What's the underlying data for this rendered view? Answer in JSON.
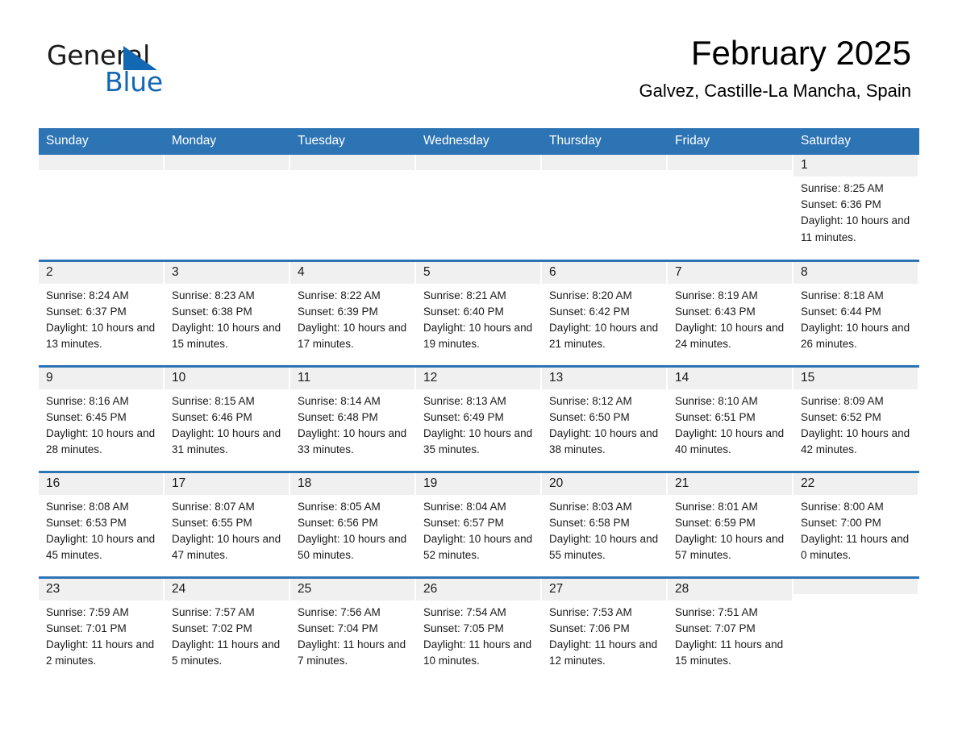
{
  "brand": {
    "name_part1": "General",
    "name_part2": "Blue",
    "accent_color": "#1268b3"
  },
  "header": {
    "title": "February 2025",
    "subtitle": "Galvez, Castille-La Mancha, Spain"
  },
  "calendar": {
    "header_color": "#2d74b5",
    "weekdays": [
      "Sunday",
      "Monday",
      "Tuesday",
      "Wednesday",
      "Thursday",
      "Friday",
      "Saturday"
    ],
    "weeks": [
      [
        {
          "day": ""
        },
        {
          "day": ""
        },
        {
          "day": ""
        },
        {
          "day": ""
        },
        {
          "day": ""
        },
        {
          "day": ""
        },
        {
          "day": "1",
          "sunrise": "Sunrise: 8:25 AM",
          "sunset": "Sunset: 6:36 PM",
          "daylight": "Daylight: 10 hours and 11 minutes."
        }
      ],
      [
        {
          "day": "2",
          "sunrise": "Sunrise: 8:24 AM",
          "sunset": "Sunset: 6:37 PM",
          "daylight": "Daylight: 10 hours and 13 minutes."
        },
        {
          "day": "3",
          "sunrise": "Sunrise: 8:23 AM",
          "sunset": "Sunset: 6:38 PM",
          "daylight": "Daylight: 10 hours and 15 minutes."
        },
        {
          "day": "4",
          "sunrise": "Sunrise: 8:22 AM",
          "sunset": "Sunset: 6:39 PM",
          "daylight": "Daylight: 10 hours and 17 minutes."
        },
        {
          "day": "5",
          "sunrise": "Sunrise: 8:21 AM",
          "sunset": "Sunset: 6:40 PM",
          "daylight": "Daylight: 10 hours and 19 minutes."
        },
        {
          "day": "6",
          "sunrise": "Sunrise: 8:20 AM",
          "sunset": "Sunset: 6:42 PM",
          "daylight": "Daylight: 10 hours and 21 minutes."
        },
        {
          "day": "7",
          "sunrise": "Sunrise: 8:19 AM",
          "sunset": "Sunset: 6:43 PM",
          "daylight": "Daylight: 10 hours and 24 minutes."
        },
        {
          "day": "8",
          "sunrise": "Sunrise: 8:18 AM",
          "sunset": "Sunset: 6:44 PM",
          "daylight": "Daylight: 10 hours and 26 minutes."
        }
      ],
      [
        {
          "day": "9",
          "sunrise": "Sunrise: 8:16 AM",
          "sunset": "Sunset: 6:45 PM",
          "daylight": "Daylight: 10 hours and 28 minutes."
        },
        {
          "day": "10",
          "sunrise": "Sunrise: 8:15 AM",
          "sunset": "Sunset: 6:46 PM",
          "daylight": "Daylight: 10 hours and 31 minutes."
        },
        {
          "day": "11",
          "sunrise": "Sunrise: 8:14 AM",
          "sunset": "Sunset: 6:48 PM",
          "daylight": "Daylight: 10 hours and 33 minutes."
        },
        {
          "day": "12",
          "sunrise": "Sunrise: 8:13 AM",
          "sunset": "Sunset: 6:49 PM",
          "daylight": "Daylight: 10 hours and 35 minutes."
        },
        {
          "day": "13",
          "sunrise": "Sunrise: 8:12 AM",
          "sunset": "Sunset: 6:50 PM",
          "daylight": "Daylight: 10 hours and 38 minutes."
        },
        {
          "day": "14",
          "sunrise": "Sunrise: 8:10 AM",
          "sunset": "Sunset: 6:51 PM",
          "daylight": "Daylight: 10 hours and 40 minutes."
        },
        {
          "day": "15",
          "sunrise": "Sunrise: 8:09 AM",
          "sunset": "Sunset: 6:52 PM",
          "daylight": "Daylight: 10 hours and 42 minutes."
        }
      ],
      [
        {
          "day": "16",
          "sunrise": "Sunrise: 8:08 AM",
          "sunset": "Sunset: 6:53 PM",
          "daylight": "Daylight: 10 hours and 45 minutes."
        },
        {
          "day": "17",
          "sunrise": "Sunrise: 8:07 AM",
          "sunset": "Sunset: 6:55 PM",
          "daylight": "Daylight: 10 hours and 47 minutes."
        },
        {
          "day": "18",
          "sunrise": "Sunrise: 8:05 AM",
          "sunset": "Sunset: 6:56 PM",
          "daylight": "Daylight: 10 hours and 50 minutes."
        },
        {
          "day": "19",
          "sunrise": "Sunrise: 8:04 AM",
          "sunset": "Sunset: 6:57 PM",
          "daylight": "Daylight: 10 hours and 52 minutes."
        },
        {
          "day": "20",
          "sunrise": "Sunrise: 8:03 AM",
          "sunset": "Sunset: 6:58 PM",
          "daylight": "Daylight: 10 hours and 55 minutes."
        },
        {
          "day": "21",
          "sunrise": "Sunrise: 8:01 AM",
          "sunset": "Sunset: 6:59 PM",
          "daylight": "Daylight: 10 hours and 57 minutes."
        },
        {
          "day": "22",
          "sunrise": "Sunrise: 8:00 AM",
          "sunset": "Sunset: 7:00 PM",
          "daylight": "Daylight: 11 hours and 0 minutes."
        }
      ],
      [
        {
          "day": "23",
          "sunrise": "Sunrise: 7:59 AM",
          "sunset": "Sunset: 7:01 PM",
          "daylight": "Daylight: 11 hours and 2 minutes."
        },
        {
          "day": "24",
          "sunrise": "Sunrise: 7:57 AM",
          "sunset": "Sunset: 7:02 PM",
          "daylight": "Daylight: 11 hours and 5 minutes."
        },
        {
          "day": "25",
          "sunrise": "Sunrise: 7:56 AM",
          "sunset": "Sunset: 7:04 PM",
          "daylight": "Daylight: 11 hours and 7 minutes."
        },
        {
          "day": "26",
          "sunrise": "Sunrise: 7:54 AM",
          "sunset": "Sunset: 7:05 PM",
          "daylight": "Daylight: 11 hours and 10 minutes."
        },
        {
          "day": "27",
          "sunrise": "Sunrise: 7:53 AM",
          "sunset": "Sunset: 7:06 PM",
          "daylight": "Daylight: 11 hours and 12 minutes."
        },
        {
          "day": "28",
          "sunrise": "Sunrise: 7:51 AM",
          "sunset": "Sunset: 7:07 PM",
          "daylight": "Daylight: 11 hours and 15 minutes."
        },
        {
          "day": ""
        }
      ]
    ]
  }
}
